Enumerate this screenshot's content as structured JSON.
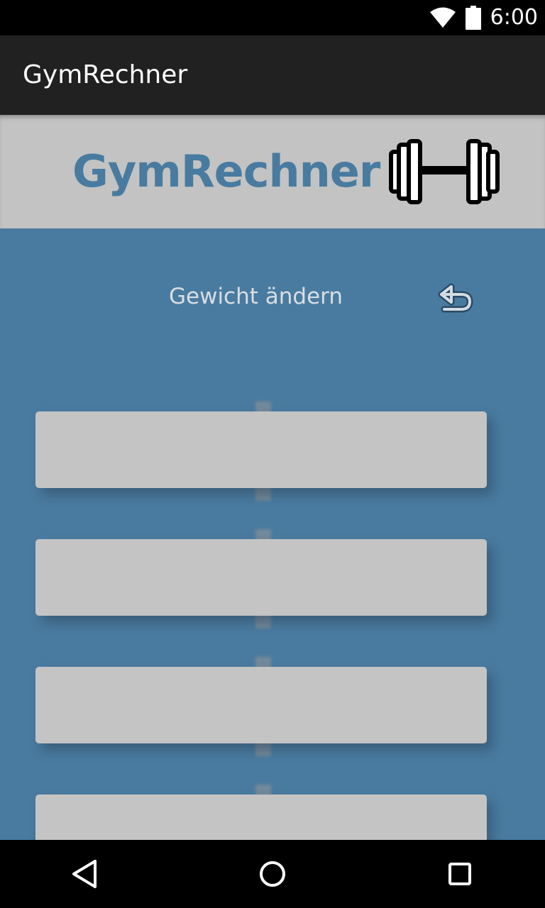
{
  "status_bar": {
    "time": "6:00",
    "icons": [
      "wifi-icon",
      "battery-icon"
    ]
  },
  "action_bar": {
    "title": "GymRechner"
  },
  "banner": {
    "title": "GymRechner",
    "logo_icon": "dumbbell-icon"
  },
  "main": {
    "change_weight_label": "Gewicht ändern",
    "undo_icon": "undo-arrow-icon",
    "weight_slots": [
      "",
      "",
      "",
      ""
    ]
  },
  "nav_bar": {
    "buttons": [
      "back-icon",
      "home-icon",
      "recents-icon"
    ]
  },
  "colors": {
    "primary": "#497ba0",
    "banner_bg": "#c3c3c3",
    "slot_bg": "#c4c4c4",
    "action_bar_bg": "#212121"
  }
}
